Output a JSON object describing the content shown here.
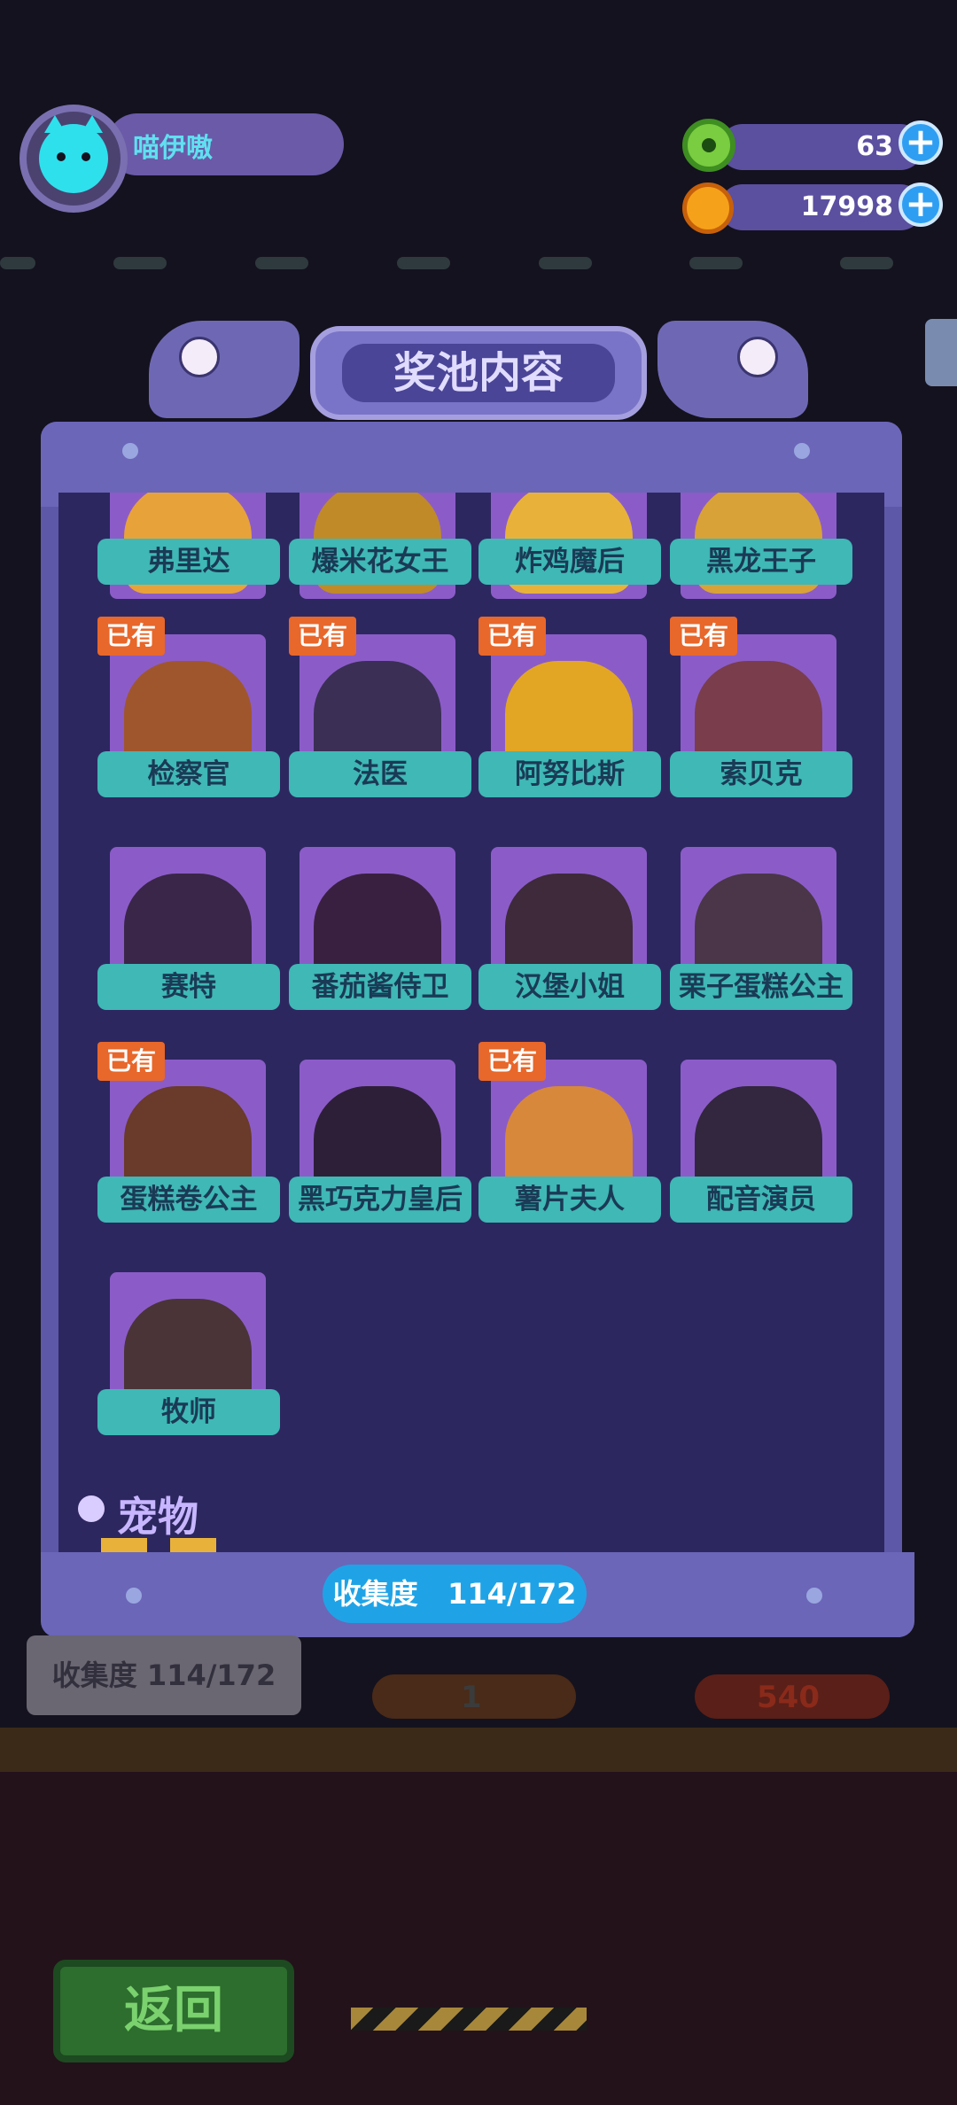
{
  "profile": {
    "username": "喵伊嗷"
  },
  "currency": {
    "donuts": "63",
    "coins": "17998"
  },
  "panel": {
    "title": "奖池内容",
    "owned_badge": "已有",
    "section_pets": "宠物",
    "collection_label": "收集度",
    "collection_value": "114/172",
    "characters": [
      {
        "name": "弗里达",
        "owned": false
      },
      {
        "name": "爆米花女王",
        "owned": false
      },
      {
        "name": "炸鸡魔后",
        "owned": false
      },
      {
        "name": "黑龙王子",
        "owned": false
      },
      {
        "name": "检察官",
        "owned": true
      },
      {
        "name": "法医",
        "owned": true
      },
      {
        "name": "阿努比斯",
        "owned": true
      },
      {
        "name": "索贝克",
        "owned": true
      },
      {
        "name": "赛特",
        "owned": false
      },
      {
        "name": "番茄酱侍卫",
        "owned": false
      },
      {
        "name": "汉堡小姐",
        "owned": false
      },
      {
        "name": "栗子蛋糕公主",
        "owned": false
      },
      {
        "name": "蛋糕卷公主",
        "owned": true
      },
      {
        "name": "黑巧克力皇后",
        "owned": false
      },
      {
        "name": "薯片夫人",
        "owned": true
      },
      {
        "name": "配音演员",
        "owned": false
      },
      {
        "name": "牧师",
        "owned": false
      }
    ]
  },
  "background": {
    "collection_text": "收集度   114/172",
    "cost_one": "1",
    "cost_two": "540",
    "back_label": "返回"
  },
  "colors": {
    "accent": "#1fa3e6",
    "owned_badge": "#e8672a",
    "label_bg": "#3fb8b6"
  }
}
